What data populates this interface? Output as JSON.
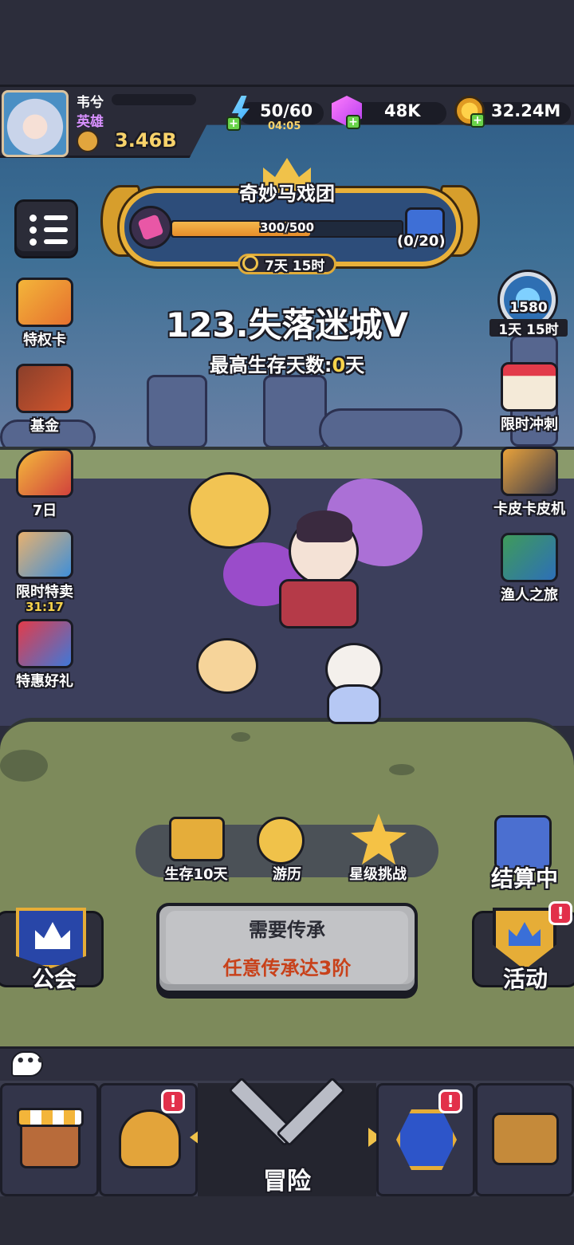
{
  "player": {
    "name": "韦兮",
    "rank": "英雄",
    "power": "3.46B"
  },
  "resources": {
    "energy": "50/60",
    "energy_timer": "04:05",
    "gems": "48K",
    "gold": "32.24M"
  },
  "event": {
    "title": "奇妙马戏团",
    "progress_text": "300/500",
    "progress_fraction": 0.6,
    "chest_count": "(0/20)",
    "timer": "7天 15时"
  },
  "stage": {
    "title": "123.失落迷城Ⅴ",
    "survival_label": "最高生存天数:",
    "survival_value": "0",
    "survival_unit": "天"
  },
  "left_icons": [
    {
      "label": "特权卡",
      "icon": "privilege-card-icon"
    },
    {
      "label": "基金",
      "icon": "fund-icon"
    },
    {
      "label": "7日",
      "icon": "seven-day-icon"
    },
    {
      "label": "限时特卖",
      "sub": "31:17",
      "icon": "limited-sale-icon"
    },
    {
      "label": "特惠好礼",
      "icon": "gift-icon"
    }
  ],
  "right_icons": {
    "rank_score": "1580",
    "rank_timer": "1天 15时",
    "items": [
      {
        "label": "限时冲刺",
        "icon": "calendar-icon"
      },
      {
        "label": "卡皮卡皮机",
        "icon": "slot-machine-icon"
      },
      {
        "label": "渔人之旅",
        "icon": "fisherman-icon"
      }
    ]
  },
  "actions": [
    {
      "label": "生存10天",
      "icon": "chest-icon"
    },
    {
      "label": "游历",
      "icon": "compass-icon"
    },
    {
      "label": "星级挑战",
      "icon": "star-icon"
    }
  ],
  "settle_label": "结算中",
  "inherit": {
    "title": "需要传承",
    "requirement": "任意传承达3阶"
  },
  "guild_label": "公会",
  "activity_label": "活动",
  "alert_mark": "!",
  "chat_dots": "•••",
  "nav": {
    "adventure_label": "冒险"
  },
  "colors": {
    "gold_text": "#f8d36b",
    "rank_purple": "#d891ff",
    "alert_red": "#e2304a",
    "requirement_red": "#c8411a"
  }
}
